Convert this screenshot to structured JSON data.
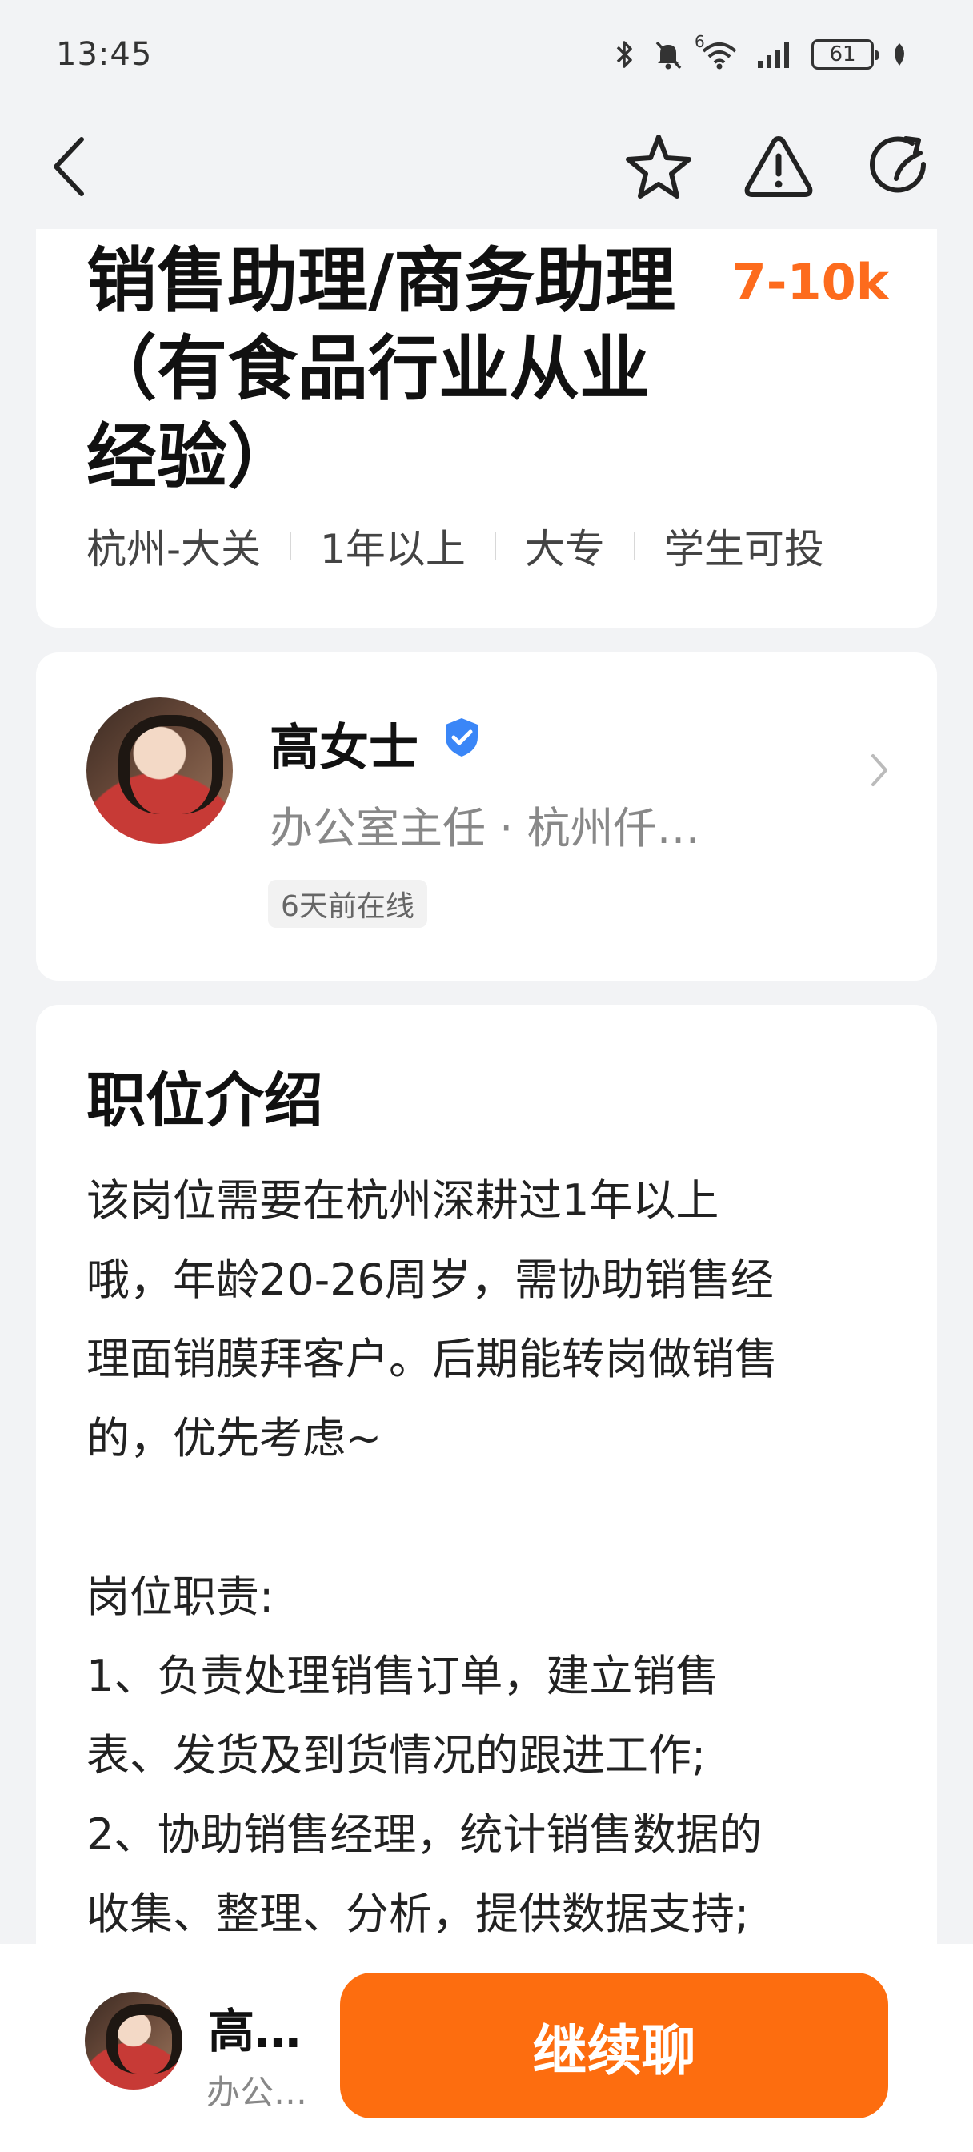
{
  "status_bar": {
    "time": "13:45",
    "battery": "61",
    "network": "6"
  },
  "job": {
    "title": "销售助理/商务助理（有食品行业从业经验）",
    "salary": "7-10k",
    "tags": [
      "杭州-大关",
      "1年以上",
      "大专",
      "学生可投"
    ],
    "accent_color": "#fd6b1d"
  },
  "recruiter": {
    "name": "高女士",
    "role": "办公室主任 · 杭州仟…",
    "online_status": "6天前在线",
    "verified_color": "#3a86f7"
  },
  "description": {
    "title": "职位介绍",
    "body": "该岗位需要在杭州深耕过1年以上\n哦，年龄20-26周岁，需协助销售经\n理面销膜拜客户。后期能转岗做销售\n的，优先考虑~\n\n岗位职责:\n1、负责处理销售订单，建立销售\n表、发货及到货情况的跟进工作;\n2、协助销售经理，统计销售数据的\n收集、整理、分析，提供数据支持;"
  },
  "bottom_bar": {
    "name": "高…",
    "role": "办公…",
    "chat_button": "继续聊",
    "button_color": "#fd6d0f"
  },
  "icons": [
    "back-icon",
    "star-icon",
    "warning-icon",
    "share-icon",
    "verified-icon",
    "chevron-right-icon"
  ]
}
